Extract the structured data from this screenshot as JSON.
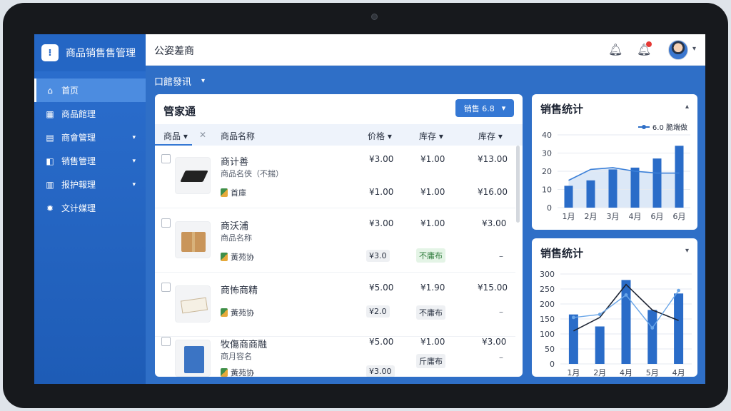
{
  "app": {
    "name": "商品销售售管理",
    "logo_glyph": "⁝"
  },
  "header": {
    "title": "公姿差商"
  },
  "sidebar": {
    "items": [
      {
        "label": "首页",
        "icon": "home-icon",
        "glyph": "⌂"
      },
      {
        "label": "商品館理",
        "icon": "grid-icon",
        "glyph": "▦"
      },
      {
        "label": "商會管理",
        "icon": "store-icon",
        "glyph": "▤"
      },
      {
        "label": "销售管理",
        "icon": "cart-icon",
        "glyph": "◧"
      },
      {
        "label": "报护報理",
        "icon": "report-icon",
        "glyph": "▥"
      },
      {
        "label": "文计媒理",
        "icon": "gear-icon",
        "glyph": "✹"
      }
    ]
  },
  "subheader": {
    "label": "口館發讯"
  },
  "panel": {
    "title": "管家通",
    "filter_label": "销售 6.8",
    "columns": {
      "category": "商品",
      "name": "商品名称",
      "price": "价格",
      "stock": "库存",
      "stock2": "库存"
    },
    "rows": [
      {
        "name": "商计善",
        "sub": "商品名侠（不揣）",
        "tag": "首庫",
        "price": "¥3.00",
        "stock": "¥1.00",
        "amount": "¥13.00",
        "price2": "¥1.00",
        "stock_2": "¥1.00",
        "amount2": "¥16.00"
      },
      {
        "name": "商沃浦",
        "sub": "商品名称",
        "tag": "黃苑协",
        "price": "¥3.00",
        "stock": "¥1.00",
        "amount": "¥3.00",
        "price2": "¥3.0",
        "stock_2": "不庸布",
        "amount2": "–"
      },
      {
        "name": "商怖商精",
        "sub": "",
        "tag": "黃苑协",
        "price": "¥5.00",
        "stock": "¥1.90",
        "amount": "¥15.00",
        "price2": "¥2.0",
        "stock_2": "不庸布",
        "amount2": "–"
      },
      {
        "name": "牧傷商商融",
        "sub": "商月容名",
        "tag": "黃苑协",
        "price": "¥5.00",
        "stock": "¥1.00",
        "amount": "¥3.00",
        "price2": "¥3.00",
        "stock_2": "斤庸布",
        "amount2": "–"
      }
    ]
  },
  "chart_data": [
    {
      "type": "bar",
      "title": "销售统计",
      "legend": "6.0 脆端做",
      "categories": [
        "1月",
        "2月",
        "3月",
        "4月",
        "6月",
        "6月"
      ],
      "values": [
        12,
        15,
        21,
        22,
        27,
        34
      ],
      "line": [
        15,
        21,
        22,
        20,
        19,
        19
      ],
      "ylim": [
        0,
        40
      ],
      "yticks": [
        "0",
        "10",
        "20",
        "30",
        "40"
      ],
      "grid": true
    },
    {
      "type": "bar",
      "title": "销售统计",
      "categories": [
        "1月",
        "2月",
        "4月",
        "5月",
        "4月"
      ],
      "values": [
        165,
        125,
        280,
        180,
        235
      ],
      "line": [
        110,
        155,
        265,
        180,
        145
      ],
      "line2": [
        155,
        165,
        230,
        120,
        245
      ],
      "ylim": [
        0,
        300
      ],
      "yticks": [
        "0",
        "50",
        "100",
        "150",
        "200",
        "250",
        "300"
      ],
      "grid": true
    }
  ],
  "colors": {
    "accent": "#2f6fc7",
    "bar": "#2a6cc8",
    "sidebar": "#2466c4"
  }
}
